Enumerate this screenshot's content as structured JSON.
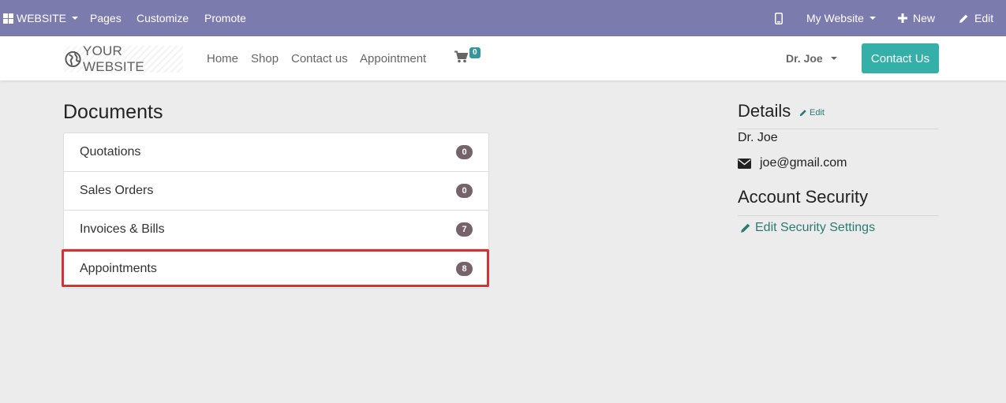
{
  "admin_bar": {
    "website_menu": "WEBSITE",
    "pages": "Pages",
    "customize": "Customize",
    "promote": "Promote",
    "my_website": "My Website",
    "new": "New",
    "edit": "Edit",
    "color": "#7c7bad"
  },
  "navbar": {
    "logo_text": "YOUR WEBSITE",
    "links": [
      "Home",
      "Shop",
      "Contact us",
      "Appointment"
    ],
    "cart_count": "0",
    "user": "Dr. Joe",
    "contact_button": "Contact Us"
  },
  "documents": {
    "title": "Documents",
    "items": [
      {
        "label": "Quotations",
        "count": "0"
      },
      {
        "label": "Sales Orders",
        "count": "0"
      },
      {
        "label": "Invoices & Bills",
        "count": "7"
      },
      {
        "label": "Appointments",
        "count": "8"
      }
    ],
    "highlighted_item": "Appointments"
  },
  "details": {
    "title": "Details",
    "edit_label": "Edit",
    "name": "Dr. Joe",
    "email": "joe@gmail.com"
  },
  "security": {
    "title": "Account Security",
    "edit_link": "Edit Security Settings"
  },
  "colors": {
    "accent": "#35b0a9",
    "link": "#2b7a72",
    "badge": "#75626b",
    "highlight": "#d63234"
  }
}
